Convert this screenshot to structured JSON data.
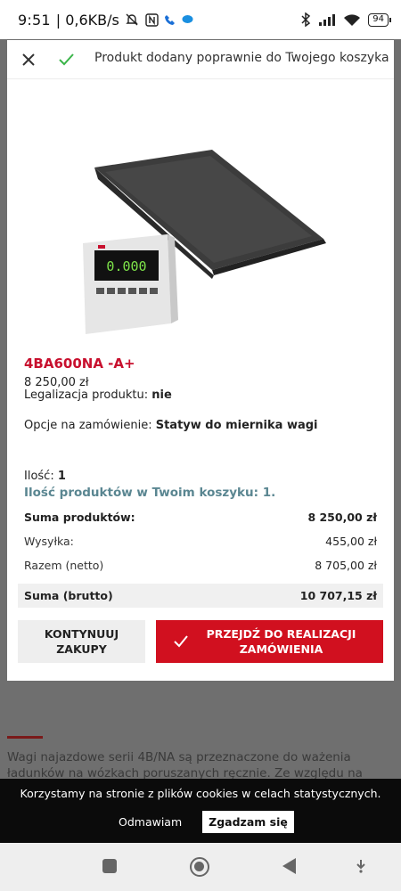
{
  "status_bar": {
    "time": "9:51",
    "speed": "| 0,6KB/s",
    "battery": "94"
  },
  "background_page": {
    "description": "Wagi najazdowe serii 4B/NA są przeznaczone do ważenia ładunków na wózkach poruszanych ręcznie. Ze względu na materiał konstrukcyjny (stal"
  },
  "modal": {
    "header_text": "Produkt dodany poprawnie do Twojego koszyka",
    "product": {
      "name": "4BA600NA -A+",
      "price": "8 250,00 zł",
      "legalization_label": "Legalizacja produktu:",
      "legalization_value": "nie",
      "options_label": "Opcje na zamówienie:",
      "options_value": "Statyw do miernika wagi",
      "display_digits": "0.000"
    },
    "quantity_label": "Ilość:",
    "quantity_value": "1",
    "cart_count_text": "Ilość produktów w Twoim koszyku: 1.",
    "summary": [
      {
        "label": "Suma produktów:",
        "value": "8 250,00 zł",
        "style": "bold"
      },
      {
        "label": "Wysyłka:",
        "value": "455,00 zł",
        "style": "norm"
      },
      {
        "label": "Razem (netto)",
        "value": "8 705,00 zł",
        "style": "norm"
      },
      {
        "label": "Suma (brutto)",
        "value": "10 707,15 zł",
        "style": "bold"
      }
    ],
    "continue_button": "KONTYNUUJ ZAKUPY",
    "checkout_button": "PRZEJDŹ DO REALIZACJI ZAMÓWIENIA"
  },
  "cookie_banner": {
    "text": "Korzystamy na stronie z plików cookies w celach statystycznych.",
    "reject_label": "Odmawiam",
    "accept_label": "Zgadzam się"
  },
  "colors": {
    "accent_red": "#d1101f",
    "product_name_red": "#c8102e",
    "cart_count_teal": "#5a8691"
  }
}
